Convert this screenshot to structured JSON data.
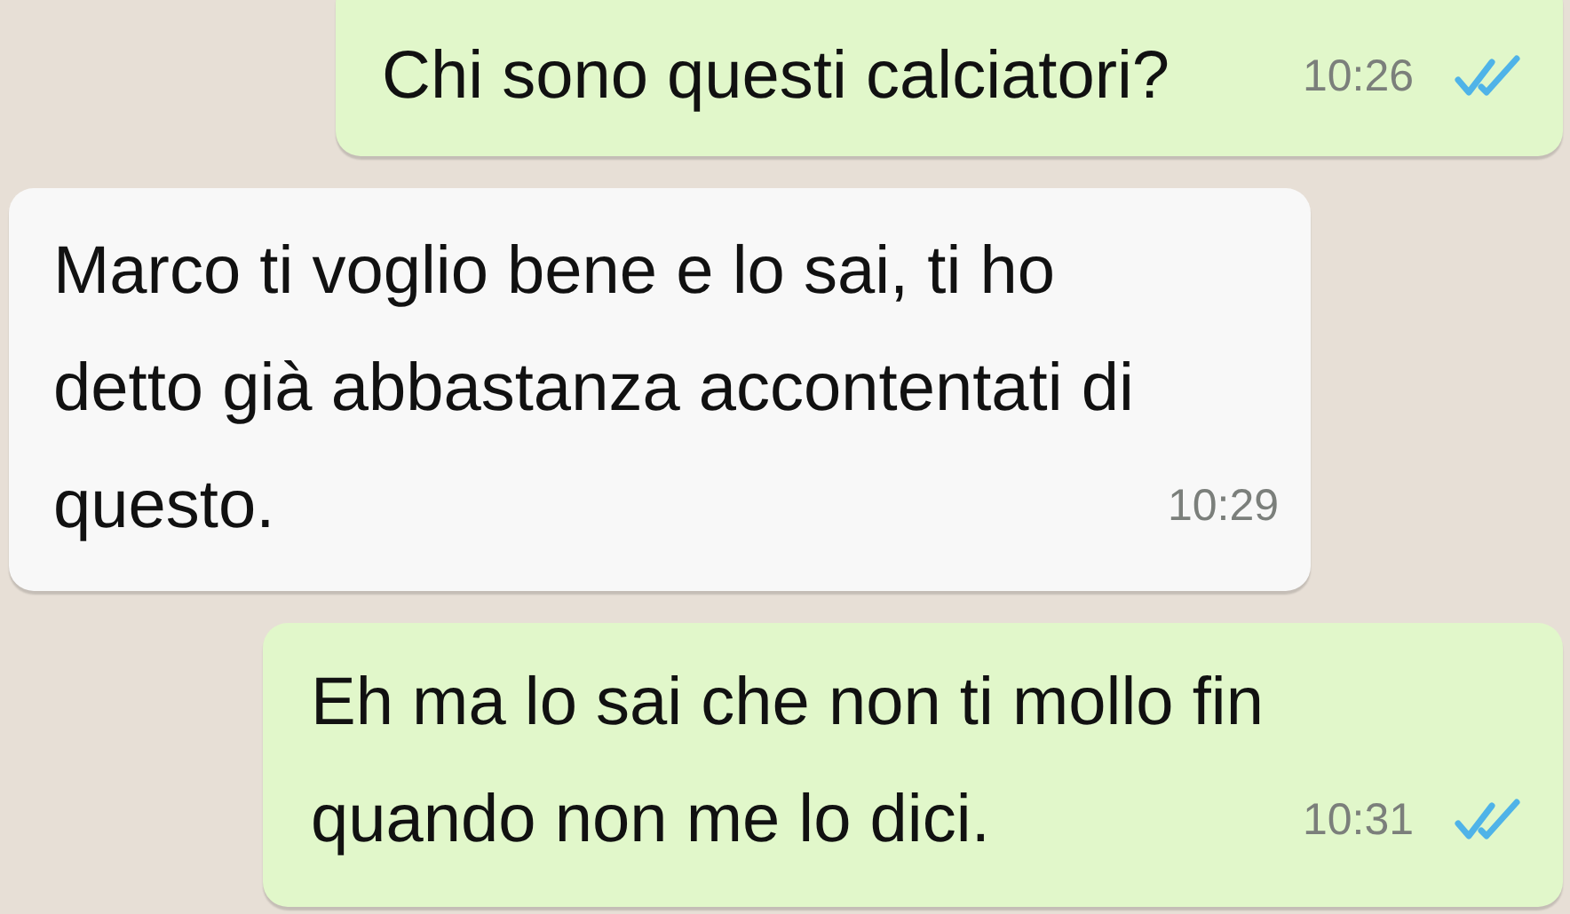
{
  "messages": [
    {
      "outgoing": true,
      "text": "Chi sono questi calciatori?",
      "time": "10:26",
      "read": true
    },
    {
      "outgoing": false,
      "text": "Marco ti voglio bene e lo sai, ti ho detto già abbastanza accontentati di questo.",
      "time": "10:29"
    },
    {
      "outgoing": true,
      "text": "Eh ma lo sai che non ti mollo fin quando non me lo dici.",
      "time": "10:31",
      "read": true
    }
  ]
}
